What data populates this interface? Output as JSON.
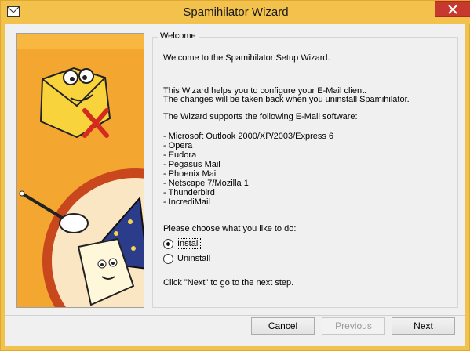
{
  "window": {
    "title": "Spamihilator Wizard",
    "app_icon": "envelope-icon",
    "close_icon": "close-icon"
  },
  "group": {
    "label": "Welcome"
  },
  "content": {
    "welcome": "Welcome to the Spamihilator Setup Wizard.",
    "help_line1": "This Wizard helps you to configure your E-Mail client.",
    "help_line2": "The changes will be taken back when you uninstall Spamihilator.",
    "supports": "The Wizard supports the following E-Mail software:",
    "software": [
      "- Microsoft Outlook 2000/XP/2003/Express 6",
      "- Opera",
      "- Eudora",
      "- Pegasus Mail",
      "- Phoenix Mail",
      "- Netscape 7/Mozilla 1",
      "- Thunderbird",
      "- IncrediMail"
    ],
    "choose": "Please choose what you like to do:",
    "options": [
      {
        "label": "Install",
        "selected": true
      },
      {
        "label": "Uninstall",
        "selected": false
      }
    ],
    "next_hint": "Click \"Next\" to go to the next step."
  },
  "buttons": {
    "cancel": "Cancel",
    "previous": "Previous",
    "next": "Next"
  },
  "colors": {
    "title_bar": "#f3c24c",
    "close": "#c7382f",
    "panel_orange": "#f0a02a",
    "panel_dark": "#c5451a"
  }
}
